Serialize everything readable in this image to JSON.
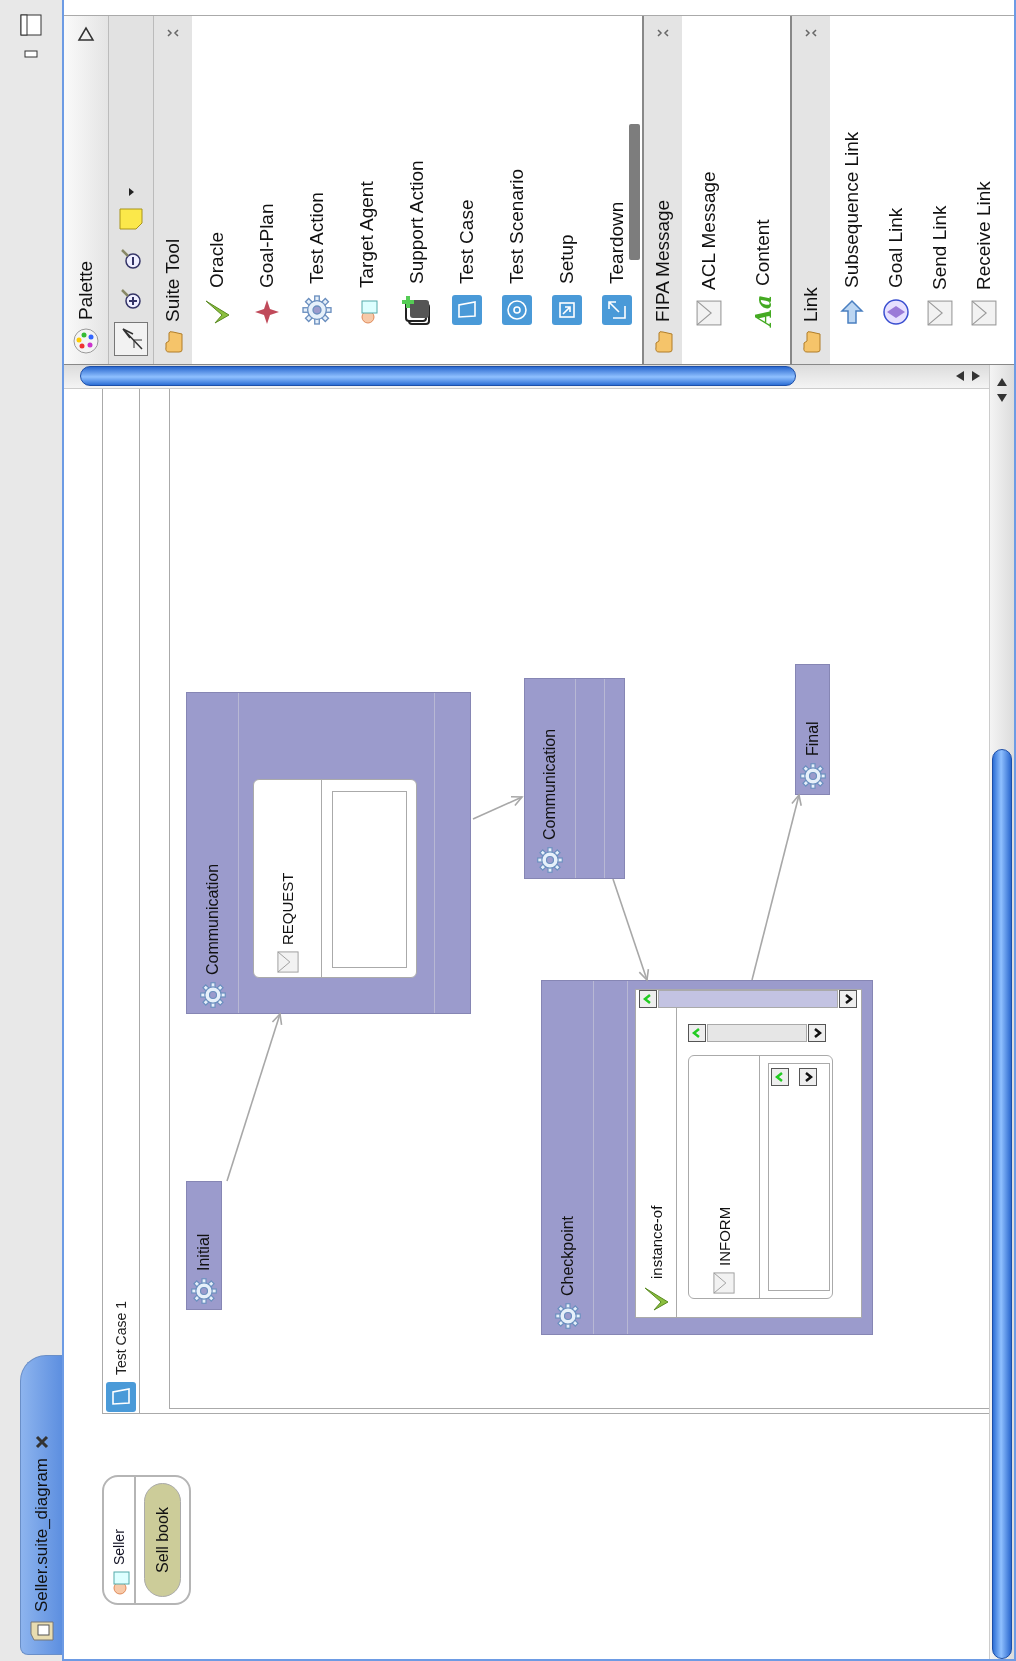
{
  "editor_tab": {
    "title": "Seller.suite_diagram"
  },
  "diagram": {
    "pool": {
      "name": "Seller",
      "task": "Sell book"
    },
    "test_case": {
      "title": "Test Case 1"
    },
    "nodes": [
      {
        "kind": "initial",
        "label": "Initial"
      },
      {
        "kind": "communication",
        "label": "Communication",
        "message": "REQUEST"
      },
      {
        "kind": "communication",
        "label": "Communication"
      },
      {
        "kind": "checkpoint",
        "label": "Checkpoint",
        "condition": "instance-of",
        "message": "INFORM"
      },
      {
        "kind": "final",
        "label": "Final"
      }
    ]
  },
  "palette": {
    "title": "Palette",
    "tools": [
      {
        "kind": "select",
        "selected": true
      },
      {
        "kind": "zoom_in",
        "selected": false
      },
      {
        "kind": "zoom_out",
        "selected": false
      },
      {
        "kind": "note",
        "selected": false
      }
    ],
    "drawers": [
      {
        "title": "Suite Tool",
        "items": [
          {
            "kind": "oracle",
            "label": "Oracle"
          },
          {
            "kind": "goal_plan",
            "label": "Goal-Plan"
          },
          {
            "kind": "action",
            "label": "Test Action"
          },
          {
            "kind": "agent",
            "label": "Target Agent"
          },
          {
            "kind": "support",
            "label": "Support Action"
          },
          {
            "kind": "test_case",
            "label": "Test Case"
          },
          {
            "kind": "test_scenario",
            "label": "Test Scenario"
          },
          {
            "kind": "setup",
            "label": "Setup"
          },
          {
            "kind": "teardown",
            "label": "Teardown"
          }
        ]
      },
      {
        "title": "FIPA Message",
        "items": [
          {
            "kind": "message",
            "label": "ACL Message"
          },
          {
            "kind": "content",
            "label": "Content",
            "glyph": "Aa"
          }
        ]
      },
      {
        "title": "Link",
        "items": [
          {
            "kind": "subsequence",
            "label": "Subsequence Link"
          },
          {
            "kind": "goal_link",
            "label": "Goal Link"
          },
          {
            "kind": "message",
            "label": "Send Link"
          },
          {
            "kind": "message",
            "label": "Receive Link"
          }
        ]
      }
    ]
  }
}
